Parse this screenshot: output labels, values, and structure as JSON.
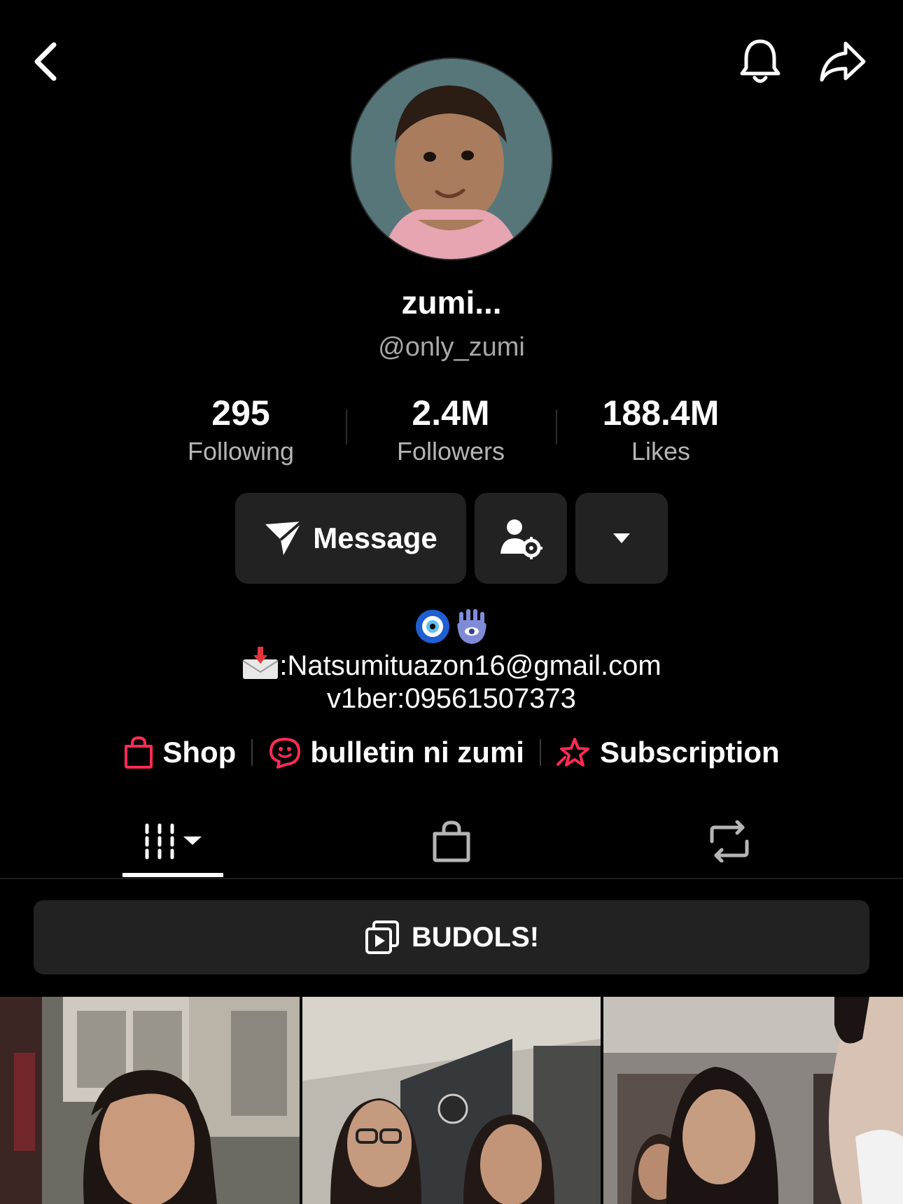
{
  "header": {
    "back_icon": "chevron-left-icon",
    "notification_icon": "bell-icon",
    "share_icon": "share-arrow-icon"
  },
  "profile": {
    "display_name": "zumi...",
    "username": "@only_zumi"
  },
  "stats": {
    "following": {
      "value": "295",
      "label": "Following"
    },
    "followers": {
      "value": "2.4M",
      "label": "Followers"
    },
    "likes": {
      "value": "188.4M",
      "label": "Likes"
    }
  },
  "actions": {
    "message_label": "Message",
    "message_icon": "paper-plane-icon",
    "friend_settings_icon": "user-gear-icon",
    "more_icon": "caret-down-icon"
  },
  "bio": {
    "emojis": [
      "nazar-amulet-icon",
      "hamsa-icon"
    ],
    "line1_text": ":Natsumituazon16@gmail.com",
    "line1_icon": "envelope-arrow-icon",
    "line2_text": "v1ber:09561507373"
  },
  "links": {
    "shop_label": "Shop",
    "bulletin_label": "bulletin ni zumi",
    "subscription_label": "Subscription",
    "accent_color": "#fe2c55"
  },
  "tabs": {
    "videos_icon": "grid-columns-icon",
    "shop_icon": "shopping-bag-icon",
    "reposts_icon": "repost-icon",
    "active": "videos"
  },
  "playlist": {
    "label": "BUDOLS!",
    "icon": "playlist-icon"
  },
  "videos": [
    {
      "name": "video-thumbnail-1"
    },
    {
      "name": "video-thumbnail-2"
    },
    {
      "name": "video-thumbnail-3"
    }
  ]
}
